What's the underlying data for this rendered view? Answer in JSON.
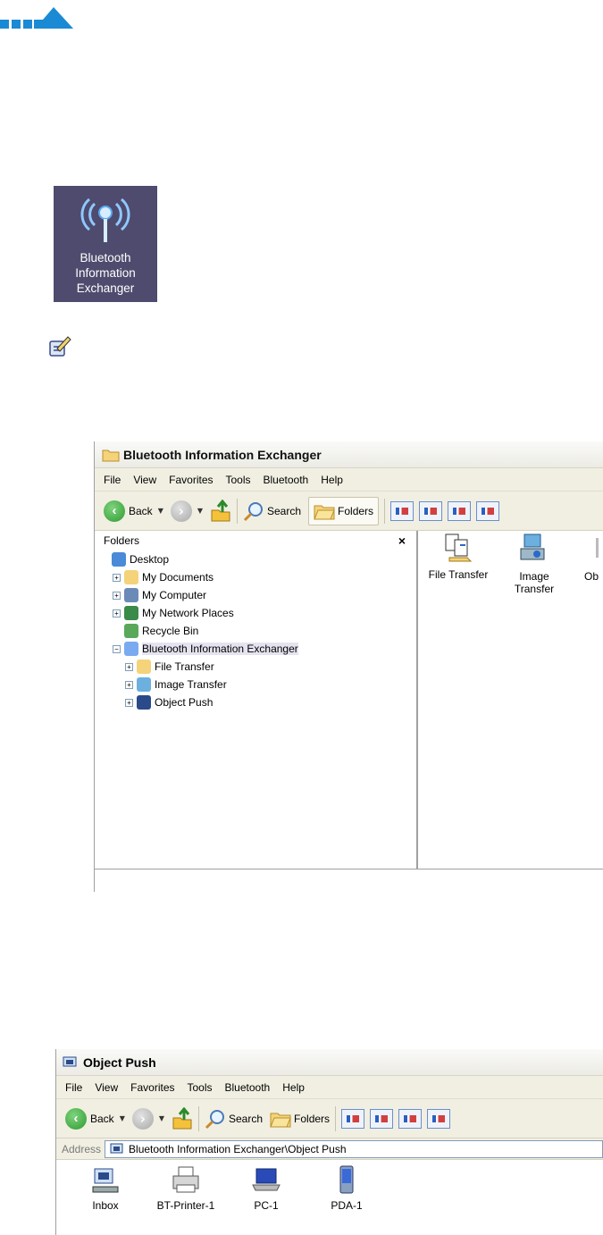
{
  "desktop_icon": {
    "line1": "Bluetooth",
    "line2": "Information",
    "line3": "Exchanger"
  },
  "window1": {
    "title": "Bluetooth Information Exchanger",
    "menu": [
      "File",
      "View",
      "Favorites",
      "Tools",
      "Bluetooth",
      "Help"
    ],
    "toolbar": {
      "back": "Back",
      "search": "Search",
      "folders": "Folders"
    },
    "folders_pane": {
      "title": "Folders",
      "close": "×",
      "tree": [
        {
          "label": "Desktop",
          "icon": "desktop-icon",
          "expander": false
        },
        {
          "label": "My Documents",
          "icon": "my-documents-icon",
          "expander": true
        },
        {
          "label": "My Computer",
          "icon": "my-computer-icon",
          "expander": true
        },
        {
          "label": "My Network Places",
          "icon": "network-places-icon",
          "expander": true
        },
        {
          "label": "Recycle Bin",
          "icon": "recycle-bin-icon",
          "expander": false
        },
        {
          "label": "Bluetooth Information Exchanger",
          "icon": "bluetooth-antenna-icon",
          "expander": true
        },
        {
          "label": "File Transfer",
          "icon": "file-transfer-icon",
          "expander": true
        },
        {
          "label": "Image Transfer",
          "icon": "image-transfer-icon",
          "expander": true
        },
        {
          "label": "Object Push",
          "icon": "object-push-icon",
          "expander": true
        }
      ]
    },
    "items": [
      {
        "label": "File Transfer"
      },
      {
        "label_line1": "Image",
        "label_line2": "Transfer"
      },
      {
        "label": "Ob"
      }
    ]
  },
  "window2": {
    "title": "Object Push",
    "menu": [
      "File",
      "View",
      "Favorites",
      "Tools",
      "Bluetooth",
      "Help"
    ],
    "toolbar": {
      "back": "Back",
      "search": "Search",
      "folders": "Folders"
    },
    "address_label": "Address",
    "address_value": "Bluetooth Information Exchanger\\Object Push",
    "devices": [
      "Inbox",
      "BT-Printer-1",
      "PC-1",
      "PDA-1"
    ]
  },
  "colors": {
    "desktop_tile": "#4e4b6e",
    "toolbar_bg": "#f1efe2",
    "selection": "#e4e3f0",
    "logo_blue": "#1a8ad4"
  }
}
